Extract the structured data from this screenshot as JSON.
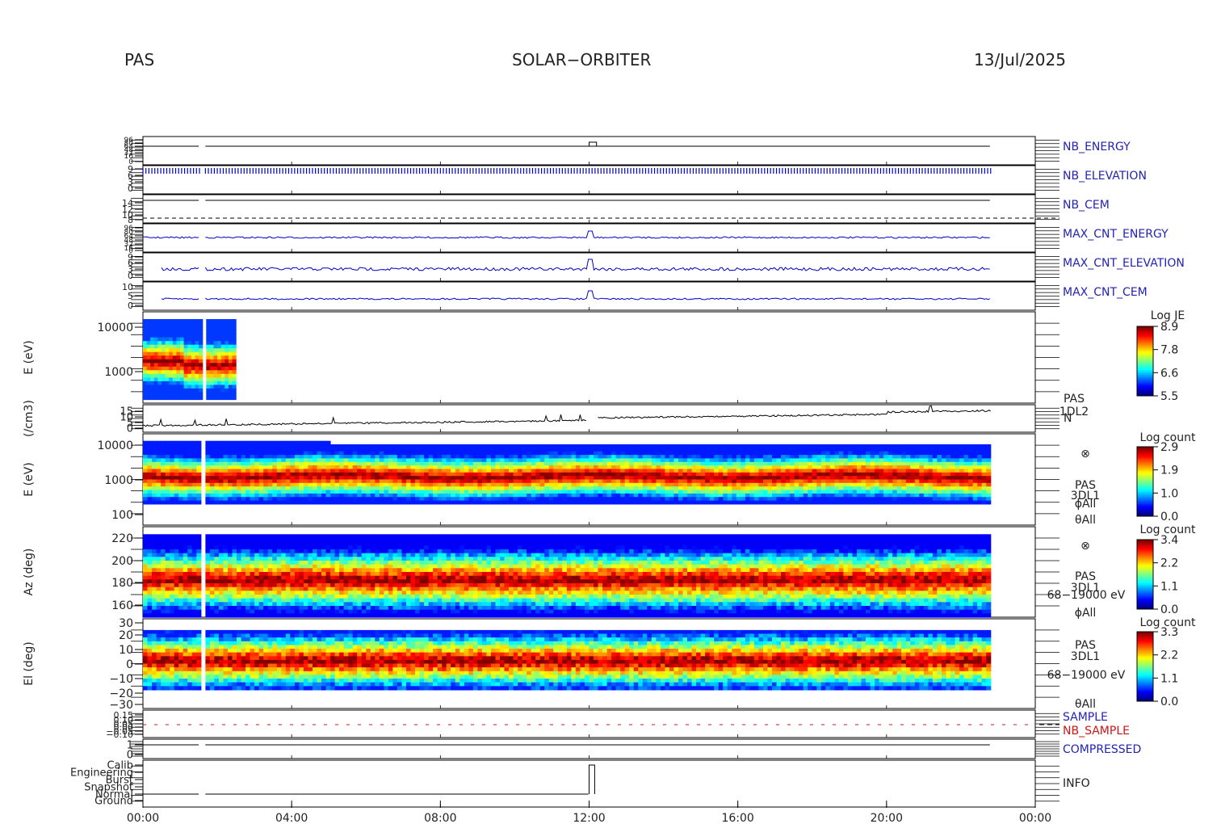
{
  "header": {
    "instrument": "PAS",
    "mission": "SOLAR−ORBITER",
    "date": "13/Jul/2025"
  },
  "colors": {
    "trace_blue": "#0000c8",
    "trace_black": "#000000",
    "label_blue": "#2323b4",
    "label_red": "#d21414"
  },
  "x_ticks": [
    "00:00",
    "04:00",
    "08:00",
    "12:00",
    "16:00",
    "20:00",
    "00:00"
  ],
  "chart_data": [
    {
      "type": "line",
      "right_label": "NB_ENERGY",
      "y_tick_labels": [
        "96",
        "80",
        "64",
        "48",
        "32",
        "16",
        "0"
      ],
      "trace": "flat with step up near 12:00"
    },
    {
      "type": "line",
      "right_label": "NB_ELEVATION",
      "y_tick_labels": [
        "9",
        "6",
        "3",
        "0"
      ]
    },
    {
      "type": "line",
      "right_label": "NB_CEM",
      "y_tick_labels": [
        "14",
        "12",
        "10",
        "8"
      ]
    },
    {
      "type": "line",
      "right_label": "MAX_CNT_ENERGY",
      "y_tick_labels": [
        "96",
        "80",
        "64",
        "48",
        "32",
        "16",
        "0"
      ]
    },
    {
      "type": "line",
      "right_label": "MAX_CNT_ELEVATION",
      "y_tick_labels": [
        "9",
        "6",
        "3",
        "0"
      ]
    },
    {
      "type": "line",
      "right_label": "MAX_CNT_CEM",
      "y_tick_labels": [
        "10",
        "5",
        "0"
      ]
    },
    {
      "type": "heatmap",
      "ylabel": "E (eV)",
      "y_tick_labels": [
        "10000",
        "1000"
      ],
      "yscale": "log",
      "right_labels": [
        "PAS",
        "1DL2"
      ],
      "colorbar": {
        "title": "Log JE",
        "ticks": [
          "8.9",
          "7.8",
          "6.6",
          "5.5"
        ]
      }
    },
    {
      "type": "line",
      "ylabel": "(/cm3)",
      "y_tick_labels": [
        "15",
        "10",
        "5",
        "0"
      ],
      "right_label": "N"
    },
    {
      "type": "heatmap",
      "ylabel": "E (eV)",
      "y_tick_labels": [
        "10000",
        "1000",
        "100"
      ],
      "yscale": "log",
      "right_labels": [
        "⊗",
        "PAS",
        "3DL1",
        "ϕAll",
        "θAll"
      ],
      "colorbar": {
        "title": "Log count",
        "ticks": [
          "2.9",
          "1.9",
          "1.0",
          "0.0"
        ]
      }
    },
    {
      "type": "heatmap",
      "ylabel": "Az (deg)",
      "y_tick_labels": [
        "220",
        "200",
        "180",
        "160"
      ],
      "right_labels": [
        "⊗",
        "PAS",
        "3DL1",
        "68−19000 eV",
        "ϕAll"
      ],
      "colorbar": {
        "title": "Log count",
        "ticks": [
          "3.4",
          "2.2",
          "1.1",
          "0.0"
        ]
      }
    },
    {
      "type": "heatmap",
      "ylabel": "El (deg)",
      "y_tick_labels": [
        "30",
        "20",
        "10",
        "0",
        "−10",
        "−20",
        "−30"
      ],
      "right_labels": [
        "PAS",
        "3DL1",
        "68−19000 eV",
        "θAll"
      ],
      "colorbar": {
        "title": "Log count",
        "ticks": [
          "3.3",
          "2.2",
          "1.1",
          "0.0"
        ]
      }
    },
    {
      "type": "line",
      "y_tick_labels": [
        "0.15",
        "0.10",
        "0.05",
        "0.00",
        "−0.05",
        "−0.10"
      ],
      "right_labels": [
        "SAMPLE",
        "NB_SAMPLE"
      ]
    },
    {
      "type": "line",
      "y_tick_labels": [
        "1",
        "0"
      ],
      "right_label": "COMPRESSED"
    },
    {
      "type": "line",
      "y_tick_labels": [
        "Calib",
        "Engineering",
        "Burst",
        "Snapshot",
        "Normal",
        "Ground"
      ],
      "right_label": "INFO"
    }
  ]
}
